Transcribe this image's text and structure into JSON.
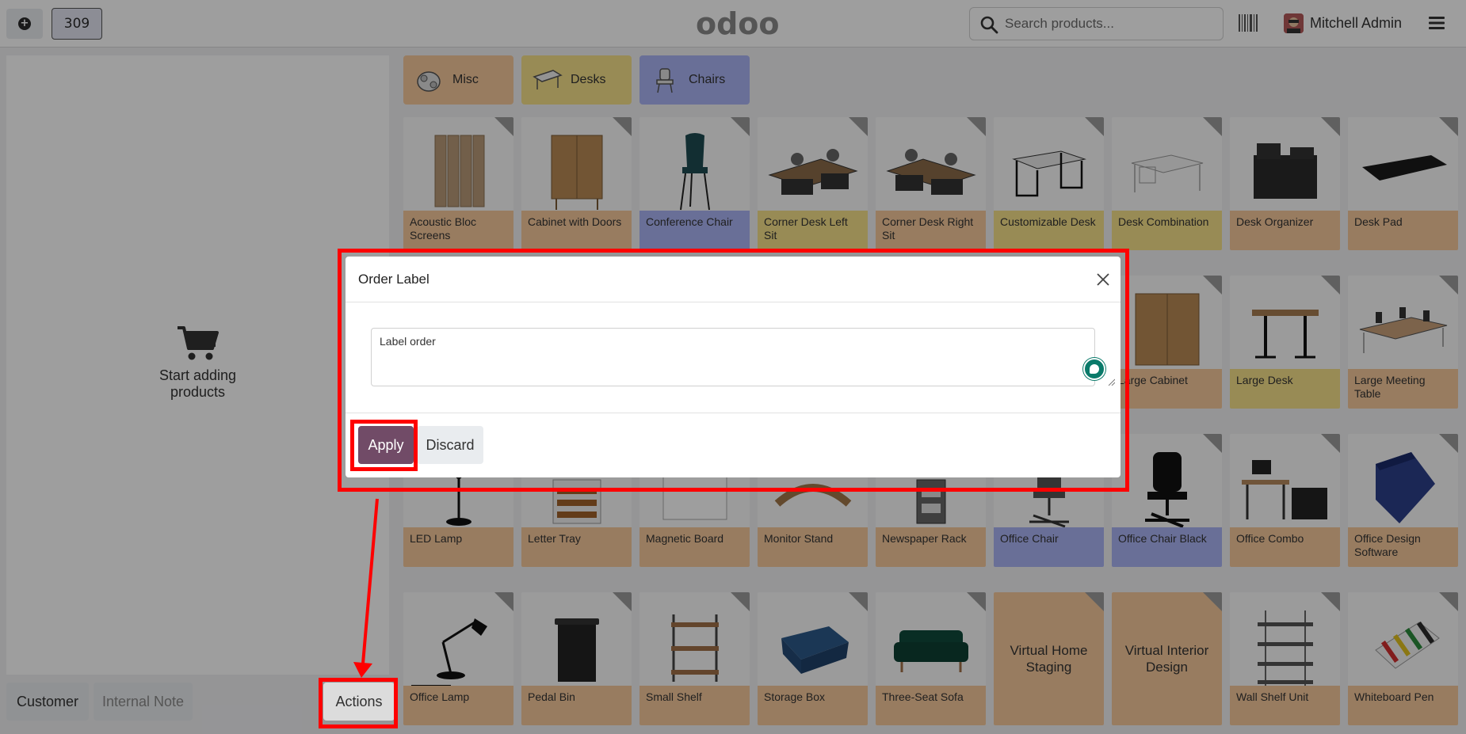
{
  "topbar": {
    "order_number": "309",
    "logo_text": "odoo",
    "search_placeholder": "Search products...",
    "user_name": "Mitchell Admin",
    "icons": [
      "plus-circle-icon",
      "search-icon",
      "barcode-icon",
      "avatar",
      "hamburger-menu-icon"
    ]
  },
  "left_panel": {
    "empty_message": "Start adding products",
    "customer_label": "Customer",
    "internal_note_label": "Internal Note",
    "actions_label": "Actions"
  },
  "categories": [
    {
      "label": "Misc",
      "color": "#f6c89b"
    },
    {
      "label": "Desks",
      "color": "#f6e08a"
    },
    {
      "label": "Chairs",
      "color": "#aab3f4"
    }
  ],
  "products": [
    {
      "name": "Acoustic Bloc Screens",
      "color": "orange",
      "icon": "screen-icon"
    },
    {
      "name": "Cabinet with Doors",
      "color": "orange",
      "icon": "cabinet-icon"
    },
    {
      "name": "Conference Chair",
      "color": "blue",
      "icon": "chair-icon"
    },
    {
      "name": "Corner Desk Left Sit",
      "color": "yellow",
      "icon": "desk-icon"
    },
    {
      "name": "Corner Desk Right Sit",
      "color": "orange",
      "icon": "desk-icon"
    },
    {
      "name": "Customizable Desk",
      "color": "yellow",
      "icon": "table-icon"
    },
    {
      "name": "Desk Combination",
      "color": "yellow",
      "icon": "table-icon"
    },
    {
      "name": "Desk Organizer",
      "color": "orange",
      "icon": "organizer-icon"
    },
    {
      "name": "Desk Pad",
      "color": "orange",
      "icon": "pad-icon"
    },
    {
      "name": "",
      "color": "orange",
      "icon": ""
    },
    {
      "name": "",
      "color": "orange",
      "icon": ""
    },
    {
      "name": "",
      "color": "orange",
      "icon": ""
    },
    {
      "name": "",
      "color": "orange",
      "icon": ""
    },
    {
      "name": "",
      "color": "orange",
      "icon": ""
    },
    {
      "name": "",
      "color": "orange",
      "icon": ""
    },
    {
      "name": "Large Cabinet",
      "color": "orange",
      "icon": "cabinet-icon"
    },
    {
      "name": "Large Desk",
      "color": "yellow",
      "icon": "desk-icon"
    },
    {
      "name": "Large Meeting Table",
      "color": "orange",
      "icon": "table-icon"
    },
    {
      "name": "LED Lamp",
      "color": "orange",
      "icon": "lamp-icon"
    },
    {
      "name": "Letter Tray",
      "color": "orange",
      "icon": "tray-icon"
    },
    {
      "name": "Magnetic Board",
      "color": "orange",
      "icon": "board-icon"
    },
    {
      "name": "Monitor Stand",
      "color": "orange",
      "icon": "stand-icon"
    },
    {
      "name": "Newspaper Rack",
      "color": "orange",
      "icon": "rack-icon"
    },
    {
      "name": "Office Chair",
      "color": "blue",
      "icon": "chair-icon"
    },
    {
      "name": "Office Chair Black",
      "color": "blue",
      "icon": "chair-icon"
    },
    {
      "name": "Office Combo",
      "color": "orange",
      "icon": "desk-icon"
    },
    {
      "name": "Office Design Software",
      "color": "orange",
      "icon": "box-icon"
    },
    {
      "name": "Office Lamp",
      "color": "orange",
      "icon": "lamp-icon"
    },
    {
      "name": "Pedal Bin",
      "color": "orange",
      "icon": "bin-icon"
    },
    {
      "name": "Small Shelf",
      "color": "orange",
      "icon": "shelf-icon"
    },
    {
      "name": "Storage Box",
      "color": "orange",
      "icon": "box-icon"
    },
    {
      "name": "Three-Seat Sofa",
      "color": "orange",
      "icon": "sofa-icon"
    },
    {
      "name": "Virtual Home Staging",
      "color": "orange",
      "icon": "",
      "text_only": true
    },
    {
      "name": "Virtual Interior Design",
      "color": "orange",
      "icon": "",
      "text_only": true
    },
    {
      "name": "Wall Shelf Unit",
      "color": "orange",
      "icon": "shelf-icon"
    },
    {
      "name": "Whiteboard Pen",
      "color": "orange",
      "icon": "pen-icon"
    }
  ],
  "dialog": {
    "title": "Order Label",
    "textarea_value": "Label order",
    "apply_label": "Apply",
    "discard_label": "Discard"
  },
  "colors": {
    "brand": "#714b67",
    "annotation_red": "#ff0000",
    "cat_orange": "#f6c89b",
    "cat_yellow": "#f6e08a",
    "cat_blue": "#aab3f4"
  }
}
